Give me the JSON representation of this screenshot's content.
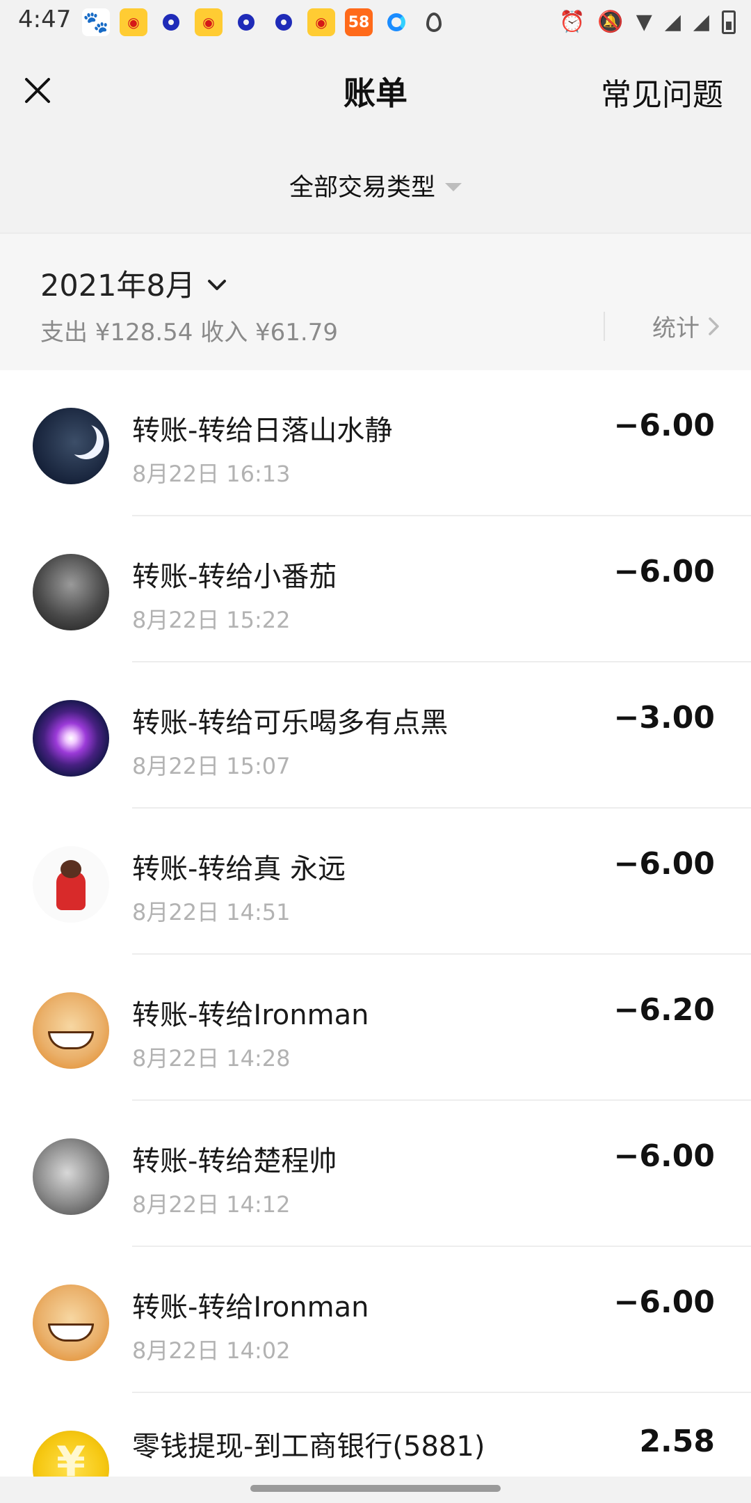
{
  "status_bar": {
    "time": "4:47",
    "notification_icons": [
      "baidu-icon",
      "weibo-icon",
      "ring-app-icon",
      "weibo-icon",
      "ring-app-icon",
      "ring-app-icon",
      "weibo-icon",
      "app58-icon",
      "browser-icon",
      "location-pin-icon"
    ],
    "right_icons": [
      "alarm-icon",
      "mute-bell-icon",
      "wifi-icon",
      "signal-icon",
      "signal-icon",
      "battery-icon"
    ]
  },
  "header": {
    "title": "账单",
    "faq_label": "常见问题"
  },
  "filter": {
    "label": "全部交易类型"
  },
  "summary": {
    "month": "2021年8月",
    "totals": "支出 ¥128.54 收入 ¥61.79",
    "stats_label": "统计"
  },
  "transactions": [
    {
      "title": "转账-转给日落山水静",
      "time": "8月22日 16:13",
      "amount": "−6.00",
      "avatar": "moon-avatar"
    },
    {
      "title": "转账-转给小番茄",
      "time": "8月22日 15:22",
      "amount": "−6.00",
      "avatar": "portrait-avatar"
    },
    {
      "title": "转账-转给可乐喝多有点黑",
      "time": "8月22日 15:07",
      "amount": "−3.00",
      "avatar": "firework-avatar"
    },
    {
      "title": "转账-转给真 永远",
      "time": "8月22日 14:51",
      "amount": "−6.00",
      "avatar": "cartoon-avatar"
    },
    {
      "title": "转账-转给Ironman",
      "time": "8月22日 14:28",
      "amount": "−6.20",
      "avatar": "luffy-avatar"
    },
    {
      "title": "转账-转给楚程帅",
      "time": "8月22日 14:12",
      "amount": "−6.00",
      "avatar": "bw-avatar"
    },
    {
      "title": "转账-转给Ironman",
      "time": "8月22日 14:02",
      "amount": "−6.00",
      "avatar": "luffy-avatar"
    },
    {
      "title": "零钱提现-到工商银行(5881)",
      "time": "",
      "amount": "2.58",
      "avatar": "coin-avatar"
    }
  ],
  "colors": {
    "background": "#f2f2f2",
    "list_background": "#ffffff",
    "secondary_text": "#b2b2b2"
  }
}
